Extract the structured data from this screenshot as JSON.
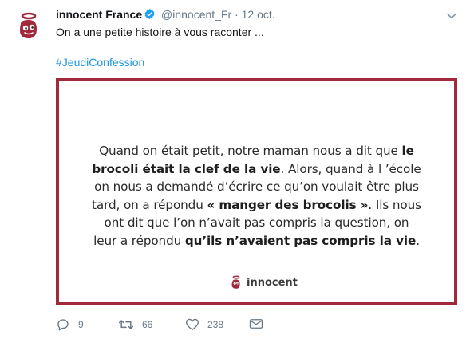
{
  "tweet": {
    "author_name": "innocent France",
    "handle": "@innocent_Fr",
    "separator": "·",
    "date": "12 oct.",
    "text": "On a une petite histoire à vous raconter ...",
    "hashtag": "#JeudiConfession"
  },
  "card": {
    "segments": [
      {
        "text": "Quand on était petit, notre maman nous a dit que ",
        "bold": false
      },
      {
        "text": "le",
        "bold": true,
        "br": true
      },
      {
        "text": "brocoli était la clef de la vie",
        "bold": true
      },
      {
        "text": ". Alors, quand à l ’école",
        "bold": false,
        "br": true
      },
      {
        "text": "on nous a demandé d’écrire ce qu’on voulait être plus",
        "bold": false,
        "br": true
      },
      {
        "text": "tard, on a répondu ",
        "bold": false
      },
      {
        "text": "« manger des brocolis »",
        "bold": true
      },
      {
        "text": ". Ils nous",
        "bold": false,
        "br": true
      },
      {
        "text": "ont dit que l’on n’avait pas compris la question, on",
        "bold": false,
        "br": true
      },
      {
        "text": "leur a répondu ",
        "bold": false
      },
      {
        "text": "qu’ils n’avaient pas compris la vie",
        "bold": true
      },
      {
        "text": ".",
        "bold": false
      }
    ],
    "brand_name": "innocent"
  },
  "actions": {
    "reply_count": "9",
    "retweet_count": "66",
    "like_count": "238"
  },
  "colors": {
    "brand_red": "#a2283b",
    "link_blue": "#1b95e0",
    "muted_gray": "#657786",
    "verified_blue": "#1da1f2"
  },
  "icons": [
    "innocent-logo-icon",
    "verified-badge-icon",
    "chevron-down-icon",
    "reply-icon",
    "retweet-icon",
    "like-icon",
    "direct-message-icon"
  ]
}
